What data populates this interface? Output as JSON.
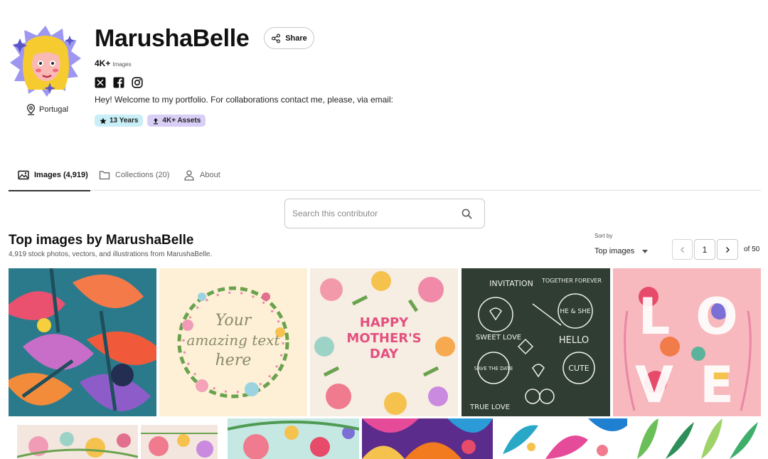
{
  "profile": {
    "name": "MarushaBelle",
    "share_label": "Share",
    "count": "4K+",
    "count_unit": "Images",
    "location": "Portugal",
    "bio": "Hey! Welcome to my portfolio. For collaborations contact me, please, via email:",
    "badges": {
      "years": "13 Years",
      "assets": "4K+ Assets"
    },
    "socials": [
      "x-icon",
      "facebook-icon",
      "instagram-icon"
    ]
  },
  "tabs": [
    {
      "label": "Images (4,919)",
      "icon": "image-icon",
      "active": true
    },
    {
      "label": "Collections (20)",
      "icon": "folder-icon",
      "active": false
    },
    {
      "label": "About",
      "icon": "user-icon",
      "active": false
    }
  ],
  "search": {
    "placeholder": "Search this contributor"
  },
  "section": {
    "title": "Top images by MarushaBelle",
    "subtitle": "4,919 stock photos, vectors, and illustrations from MarushaBelle."
  },
  "sort": {
    "label": "Sort by",
    "value": "Top images"
  },
  "pager": {
    "current": "1",
    "total_label": "of 50"
  },
  "colors": {
    "accent_years": "#c8eef7",
    "accent_assets": "#d9cef6",
    "dark_board": "#2f3d32",
    "tab_underline": "#333333"
  },
  "images": [
    {
      "name": "tropical-flowers-pattern",
      "bg": "#2b7a8c"
    },
    {
      "name": "floral-wreath-your-amazing-text",
      "bg": "#fdf0d6",
      "text": [
        "Your",
        "amazing text",
        "here"
      ]
    },
    {
      "name": "happy-mothers-day-floral",
      "bg": "#f6ede3",
      "text": [
        "HAPPY",
        "MOTHER'S",
        "DAY"
      ]
    },
    {
      "name": "chalkboard-wedding-elements",
      "bg": "#2f3d32",
      "text": [
        "INVITATION",
        "TOGETHER FOREVER",
        "SWEET LOVE",
        "HE & SHE",
        "HELLO",
        "SAVE THE DATE",
        "CUTE",
        "TRUE LOVE"
      ]
    },
    {
      "name": "love-floral-letters",
      "bg": "#f7b9bd",
      "text": [
        "L",
        "O",
        "V",
        "E"
      ]
    },
    {
      "name": "floral-border-light-1",
      "bg": "#f3e6df"
    },
    {
      "name": "floral-border-light-2",
      "bg": "#f3e6df"
    },
    {
      "name": "floral-border-mint",
      "bg": "#c5e8e3"
    },
    {
      "name": "bright-abstract-flowers",
      "bg": "#5b2c8c"
    },
    {
      "name": "tropical-leaves-white",
      "bg": "#ffffff"
    },
    {
      "name": "green-leaves-pattern",
      "bg": "#ffffff"
    }
  ]
}
